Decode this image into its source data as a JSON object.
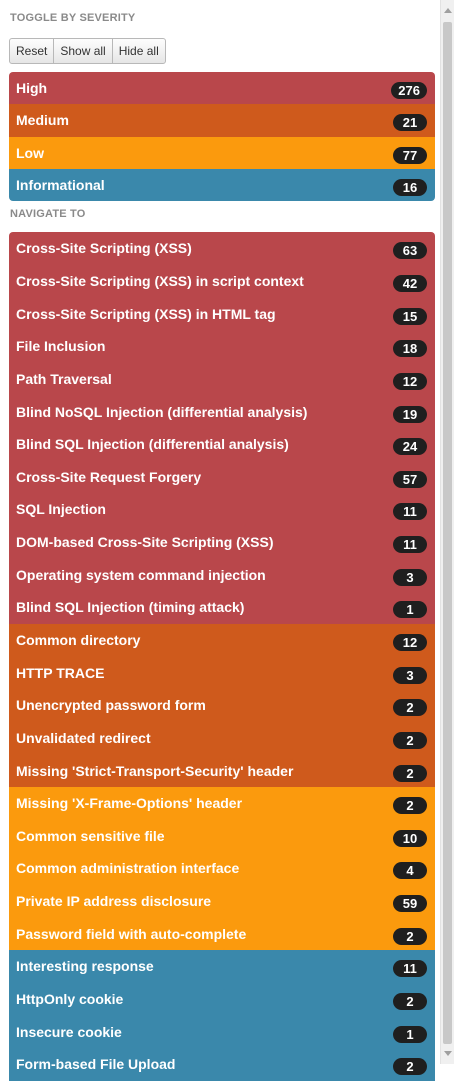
{
  "toggle_heading": "TOGGLE BY SEVERITY",
  "buttons": {
    "reset": "Reset",
    "show_all": "Show all",
    "hide_all": "Hide all"
  },
  "severity": [
    {
      "label": "High",
      "count": "276",
      "level": "high"
    },
    {
      "label": "Medium",
      "count": "21",
      "level": "medium"
    },
    {
      "label": "Low",
      "count": "77",
      "level": "low"
    },
    {
      "label": "Informational",
      "count": "16",
      "level": "info"
    }
  ],
  "navigate_heading": "NAVIGATE TO",
  "issues": [
    {
      "label": "Cross-Site Scripting (XSS)",
      "count": "63",
      "level": "high"
    },
    {
      "label": "Cross-Site Scripting (XSS) in script context",
      "count": "42",
      "level": "high"
    },
    {
      "label": "Cross-Site Scripting (XSS) in HTML tag",
      "count": "15",
      "level": "high"
    },
    {
      "label": "File Inclusion",
      "count": "18",
      "level": "high"
    },
    {
      "label": "Path Traversal",
      "count": "12",
      "level": "high"
    },
    {
      "label": "Blind NoSQL Injection (differential analysis)",
      "count": "19",
      "level": "high"
    },
    {
      "label": "Blind SQL Injection (differential analysis)",
      "count": "24",
      "level": "high"
    },
    {
      "label": "Cross-Site Request Forgery",
      "count": "57",
      "level": "high"
    },
    {
      "label": "SQL Injection",
      "count": "11",
      "level": "high"
    },
    {
      "label": "DOM-based Cross-Site Scripting (XSS)",
      "count": "11",
      "level": "high"
    },
    {
      "label": "Operating system command injection",
      "count": "3",
      "level": "high"
    },
    {
      "label": "Blind SQL Injection (timing attack)",
      "count": "1",
      "level": "high"
    },
    {
      "label": "Common directory",
      "count": "12",
      "level": "medium"
    },
    {
      "label": "HTTP TRACE",
      "count": "3",
      "level": "medium"
    },
    {
      "label": "Unencrypted password form",
      "count": "2",
      "level": "medium"
    },
    {
      "label": "Unvalidated redirect",
      "count": "2",
      "level": "medium"
    },
    {
      "label": "Missing 'Strict-Transport-Security' header",
      "count": "2",
      "level": "medium"
    },
    {
      "label": "Missing 'X-Frame-Options' header",
      "count": "2",
      "level": "low"
    },
    {
      "label": "Common sensitive file",
      "count": "10",
      "level": "low"
    },
    {
      "label": "Common administration interface",
      "count": "4",
      "level": "low"
    },
    {
      "label": "Private IP address disclosure",
      "count": "59",
      "level": "low"
    },
    {
      "label": "Password field with auto-complete",
      "count": "2",
      "level": "low"
    },
    {
      "label": "Interesting response",
      "count": "11",
      "level": "info"
    },
    {
      "label": "HttpOnly cookie",
      "count": "2",
      "level": "info"
    },
    {
      "label": "Insecure cookie",
      "count": "1",
      "level": "info"
    },
    {
      "label": "Form-based File Upload",
      "count": "2",
      "level": "info"
    }
  ],
  "colors": {
    "high": "#b9474b",
    "medium": "#cf5a1c",
    "low": "#fb9a0d",
    "info": "#3a88ab",
    "badge": "#1f1f1f"
  }
}
